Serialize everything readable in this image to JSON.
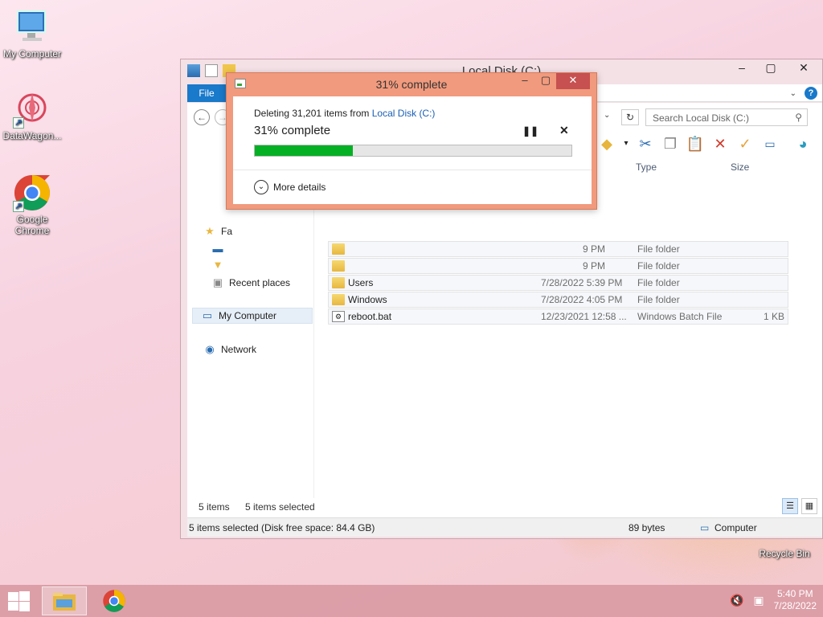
{
  "desktop": {
    "icons": [
      {
        "label": "My Computer"
      },
      {
        "label": "DataWagon..."
      },
      {
        "label": "Google Chrome"
      },
      {
        "label": "Recycle Bin"
      }
    ]
  },
  "explorer": {
    "title": "Local Disk (C:)",
    "file_tab": "File",
    "search_placeholder": "Search Local Disk (C:)",
    "columns": {
      "type": "Type",
      "size": "Size"
    },
    "nav": {
      "favorites": "Fa",
      "recent": "Recent places",
      "my_computer": "My Computer",
      "network": "Network"
    },
    "rows": [
      {
        "name": "",
        "date": "9 PM",
        "type": "File folder",
        "size": ""
      },
      {
        "name": "",
        "date": "9 PM",
        "type": "File folder",
        "size": ""
      },
      {
        "name": "Users",
        "date": "7/28/2022 5:39 PM",
        "type": "File folder",
        "size": ""
      },
      {
        "name": "Windows",
        "date": "7/28/2022 4:05 PM",
        "type": "File folder",
        "size": ""
      },
      {
        "name": "reboot.bat",
        "date": "12/23/2021 12:58 ...",
        "type": "Windows Batch File",
        "size": "1 KB"
      }
    ],
    "count": {
      "items": "5 items",
      "selected": "5 items selected"
    },
    "status": {
      "selection": "5 items selected (Disk free space: 84.4 GB)",
      "bytes": "89 bytes",
      "location": "Computer"
    }
  },
  "dialog": {
    "title": "31% complete",
    "line_prefix": "Deleting 31,201 items from ",
    "line_source": "Local Disk (C:)",
    "percent_text": "31% complete",
    "progress": 0.31,
    "more_details": "More details",
    "accent": "#06b025"
  },
  "taskbar": {
    "time": "5:40 PM",
    "date": "7/28/2022"
  }
}
